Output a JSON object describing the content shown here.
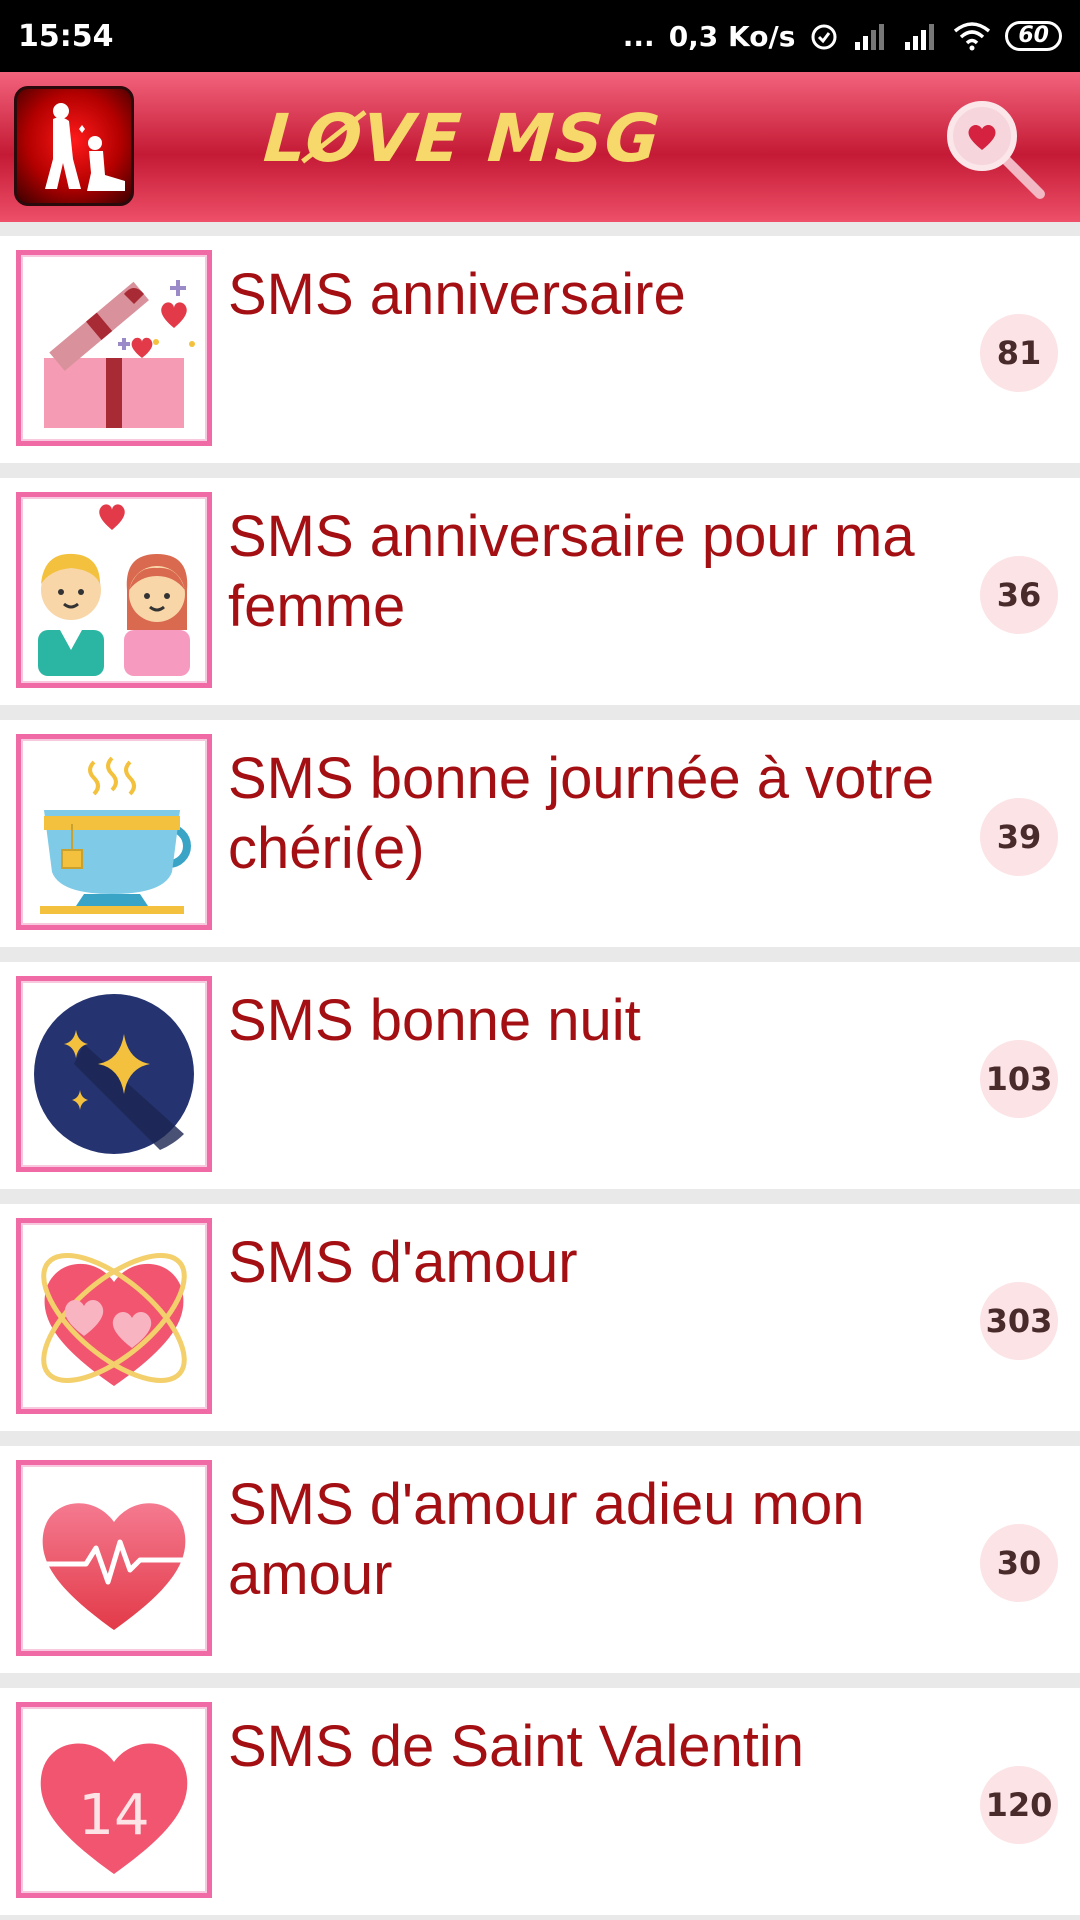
{
  "status_bar": {
    "time": "15:54",
    "dots": "...",
    "network_speed": "0,3 Ko/s",
    "battery": "60"
  },
  "app_bar": {
    "title": "LØVE MSG",
    "brand_color": "#c41a35",
    "title_color": "#f6d86b"
  },
  "categories": [
    {
      "title": "SMS anniversaire",
      "count": "81",
      "icon": "gift-hearts-icon"
    },
    {
      "title": "SMS anniversaire pour  ma femme",
      "count": "36",
      "icon": "couple-icon"
    },
    {
      "title": "SMS bonne journée à votre chéri(e)",
      "count": "39",
      "icon": "tea-cup-icon"
    },
    {
      "title": "SMS bonne nuit",
      "count": "103",
      "icon": "night-stars-icon"
    },
    {
      "title": "SMS d'amour",
      "count": "303",
      "icon": "hearts-orbit-icon"
    },
    {
      "title": "SMS d'amour adieu mon amour",
      "count": "30",
      "icon": "heartbeat-heart-icon"
    },
    {
      "title": "SMS de Saint Valentin",
      "count": "120",
      "icon": "heart-14-icon"
    }
  ]
}
